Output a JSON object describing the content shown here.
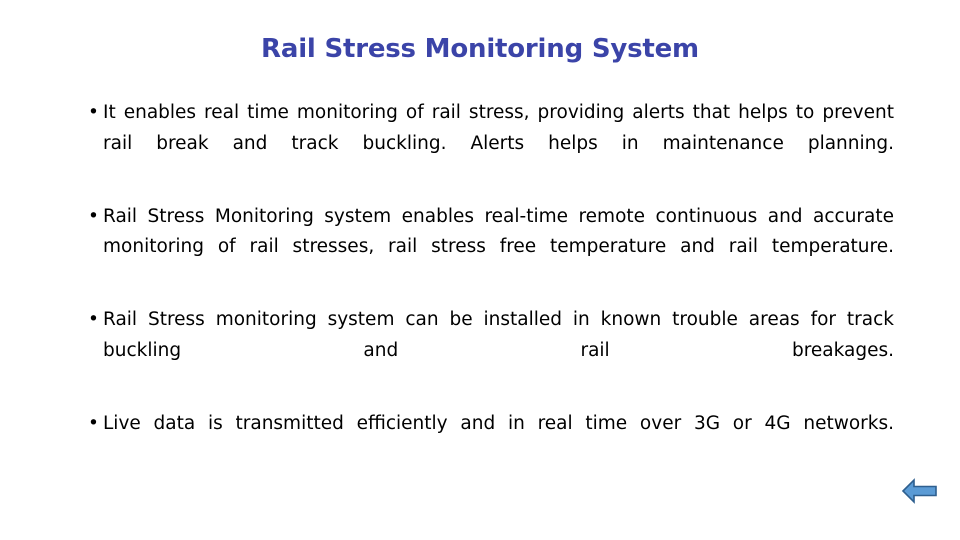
{
  "slide": {
    "title": "Rail Stress Monitoring System",
    "title_color": "#3b44a8",
    "background_color": "#ffffff",
    "bullets": [
      {
        "marker": "•",
        "text": "It enables real time monitoring of rail stress, providing alerts that helps to prevent rail break and track buckling. Alerts helps in maintenance planning."
      },
      {
        "marker": "•",
        "text": "Rail Stress Monitoring system enables real-time remote continuous and accurate monitoring of rail stresses, rail stress free temperature and rail temperature."
      },
      {
        "marker": "•",
        "text": "Rail Stress monitoring system can be installed in known trouble areas for track buckling and rail breakages."
      },
      {
        "marker": "•",
        "text": "Live data is transmitted efficiently and in real time over 3G or 4G networks."
      }
    ],
    "navigation": {
      "back_arrow": {
        "icon": "arrow-left-icon",
        "fill_color": "#5b9bd5",
        "stroke_color": "#2e5f8f"
      }
    }
  }
}
